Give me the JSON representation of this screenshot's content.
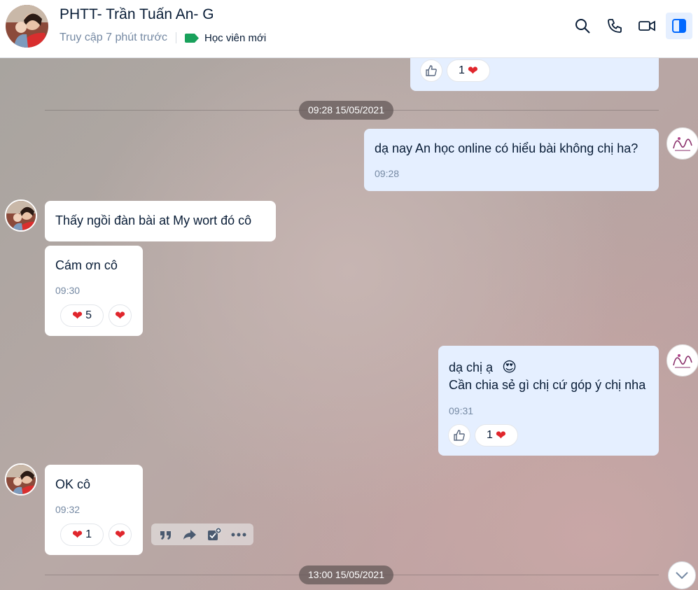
{
  "header": {
    "title": "PHTT- Trần Tuấn An- G",
    "status": "Truy cập 7 phút trước",
    "tag_label": "Học viên mới",
    "tag_color": "#19a15b",
    "icons": [
      "search-icon",
      "phone-icon",
      "video-icon",
      "sidebar-toggle-icon"
    ]
  },
  "messages": {
    "prev_reaction_count": "1",
    "divider1": "09:28 15/05/2021",
    "m1_text": "dạ nay An học online có hiểu bài không chị ha?",
    "m1_time": "09:28",
    "m2_text": "Thấy ngồi đàn bài at My wort đó cô",
    "m3_text": "Cám ơn cô",
    "m3_time": "09:30",
    "m3_reaction_count": "5",
    "m4_line1": "dạ chị ạ",
    "m4_line2": "Cần chia sẻ gì chị cứ góp ý chị nha",
    "m4_emoji": "😍",
    "m4_time": "09:31",
    "m4_reaction_count": "1",
    "m5_text": "OK cô",
    "m5_time": "09:32",
    "m5_reaction_count": "1",
    "divider2": "13:00 15/05/2021"
  },
  "colors": {
    "my_bubble": "#e5efff",
    "their_bubble": "#ffffff",
    "heart": "#e0262c",
    "accent": "#0068ff"
  }
}
